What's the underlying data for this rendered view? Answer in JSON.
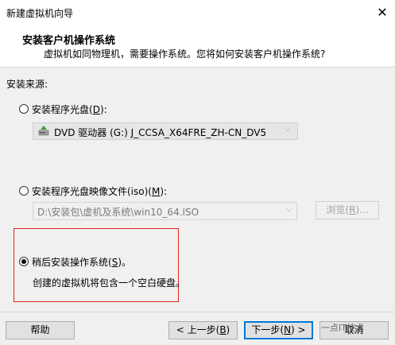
{
  "window": {
    "title": "新建虚拟机向导",
    "close_glyph": "✕"
  },
  "header": {
    "title": "安装客户机操作系统",
    "subtitle": "虚拟机如同物理机，需要操作系统。您将如何安装客户机操作系统?"
  },
  "install_source": {
    "label": "安装来源:",
    "options": [
      {
        "id": "disc",
        "label_pre": "安装程序光盘(",
        "hotkey": "D",
        "label_post": "):",
        "selected": false
      },
      {
        "id": "iso",
        "label_pre": "安装程序光盘映像文件(iso)(",
        "hotkey": "M",
        "label_post": "):",
        "selected": false
      },
      {
        "id": "later",
        "label_pre": "稍后安装操作系统(",
        "hotkey": "S",
        "label_post": ")。",
        "selected": true
      }
    ],
    "disc_drive": "DVD 驱动器 (G:) J_CCSA_X64FRE_ZH-CN_DV5",
    "iso_path": "D:\\安装包\\虚机及系统\\win10_64.ISO",
    "browse_pre": "浏览(",
    "browse_hotkey": "R",
    "browse_post": ")...",
    "later_description": "创建的虚拟机将包含一个空白硬盘。"
  },
  "footer": {
    "help": "帮助",
    "back_pre": "< 上一步(",
    "back_hotkey": "B",
    "back_post": ")",
    "next_pre": "下一步(",
    "next_hotkey": "N",
    "next_post": ") >",
    "cancel": "取消"
  },
  "watermark": "一点IT技术",
  "colors": {
    "highlight_box": "#e0241f",
    "default_button_border": "#0078d7",
    "disc_icon_green": "#3c9a3c"
  },
  "icons": {
    "disc_drive": "dvd-drive-icon",
    "dropdown": "chevron-down-icon",
    "close": "close-icon"
  }
}
